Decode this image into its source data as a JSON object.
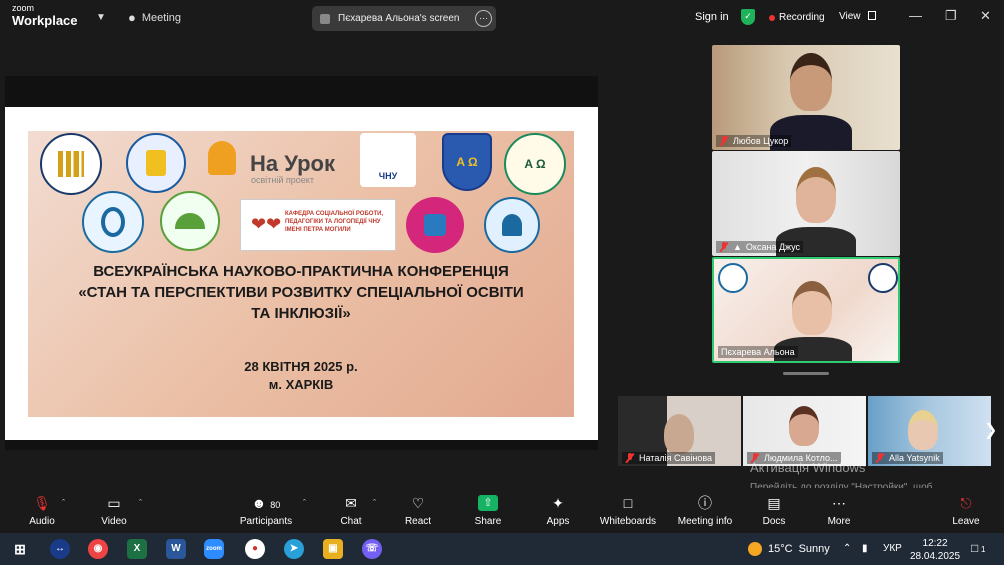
{
  "app": {
    "logo_small": "zoom",
    "logo_big": "Workplace",
    "meeting_tab": "Meeting"
  },
  "screen_share": {
    "label": "Пєхарева Альона's screen",
    "more": "···"
  },
  "header": {
    "sign_in": "Sign in",
    "recording": "Recording",
    "view": "View"
  },
  "slide": {
    "brand_name": "На Урок",
    "brand_sub": "освітній проект",
    "kafedra_text": "КАФЕДРА СОЦІАЛЬНОЇ РОБОТИ, ПЕДАГОГІКИ ТА ЛОГОПЕДІЇ ЧНУ ІМЕНІ ПЕТРА МОГИЛИ",
    "logo_chnu": "ЧНУ",
    "logo_alpha": "A Ω",
    "title_line1": "ВСЕУКРАЇНСЬКА НАУКОВО-ПРАКТИЧНА КОНФЕРЕНЦІЯ",
    "title_line2": "«СТАН ТА ПЕРСПЕКТИВИ РОЗВИТКУ СПЕЦІАЛЬНОЇ ОСВІТИ",
    "title_line3": "ТА ІНКЛЮЗІЇ»",
    "date": "28 КВІТНЯ 2025 р.",
    "city": "м. ХАРКІВ"
  },
  "participants_gallery": [
    {
      "name": "Любов Цукор"
    },
    {
      "name": "Оксана Джус"
    },
    {
      "name": "Пєхарева Альона"
    }
  ],
  "thumbnails": [
    {
      "name": "Наталія Савінова"
    },
    {
      "name": "Людмила Котло..."
    },
    {
      "name": "Alla Yatsynik"
    }
  ],
  "watermark": {
    "title": "Активація Windows",
    "sub": "Перейдіть до розділу \"Настройки\", щоб активувати Windows."
  },
  "toolbar": {
    "audio": "Audio",
    "video": "Video",
    "participants": "Participants",
    "participants_count": "80",
    "chat": "Chat",
    "react": "React",
    "share": "Share",
    "apps": "Apps",
    "whiteboards": "Whiteboards",
    "meeting_info": "Meeting info",
    "docs": "Docs",
    "more": "More",
    "leave": "Leave"
  },
  "taskbar": {
    "weather_temp": "15°C",
    "weather_desc": "Sunny",
    "lang": "УКР",
    "time": "12:22",
    "date": "28.04.2025",
    "notifications": "1"
  },
  "colors": {
    "share_green": "#16b364",
    "shield_green": "#1eb35a",
    "active_border": "#2ecc71",
    "recording_red": "#ee3333"
  }
}
